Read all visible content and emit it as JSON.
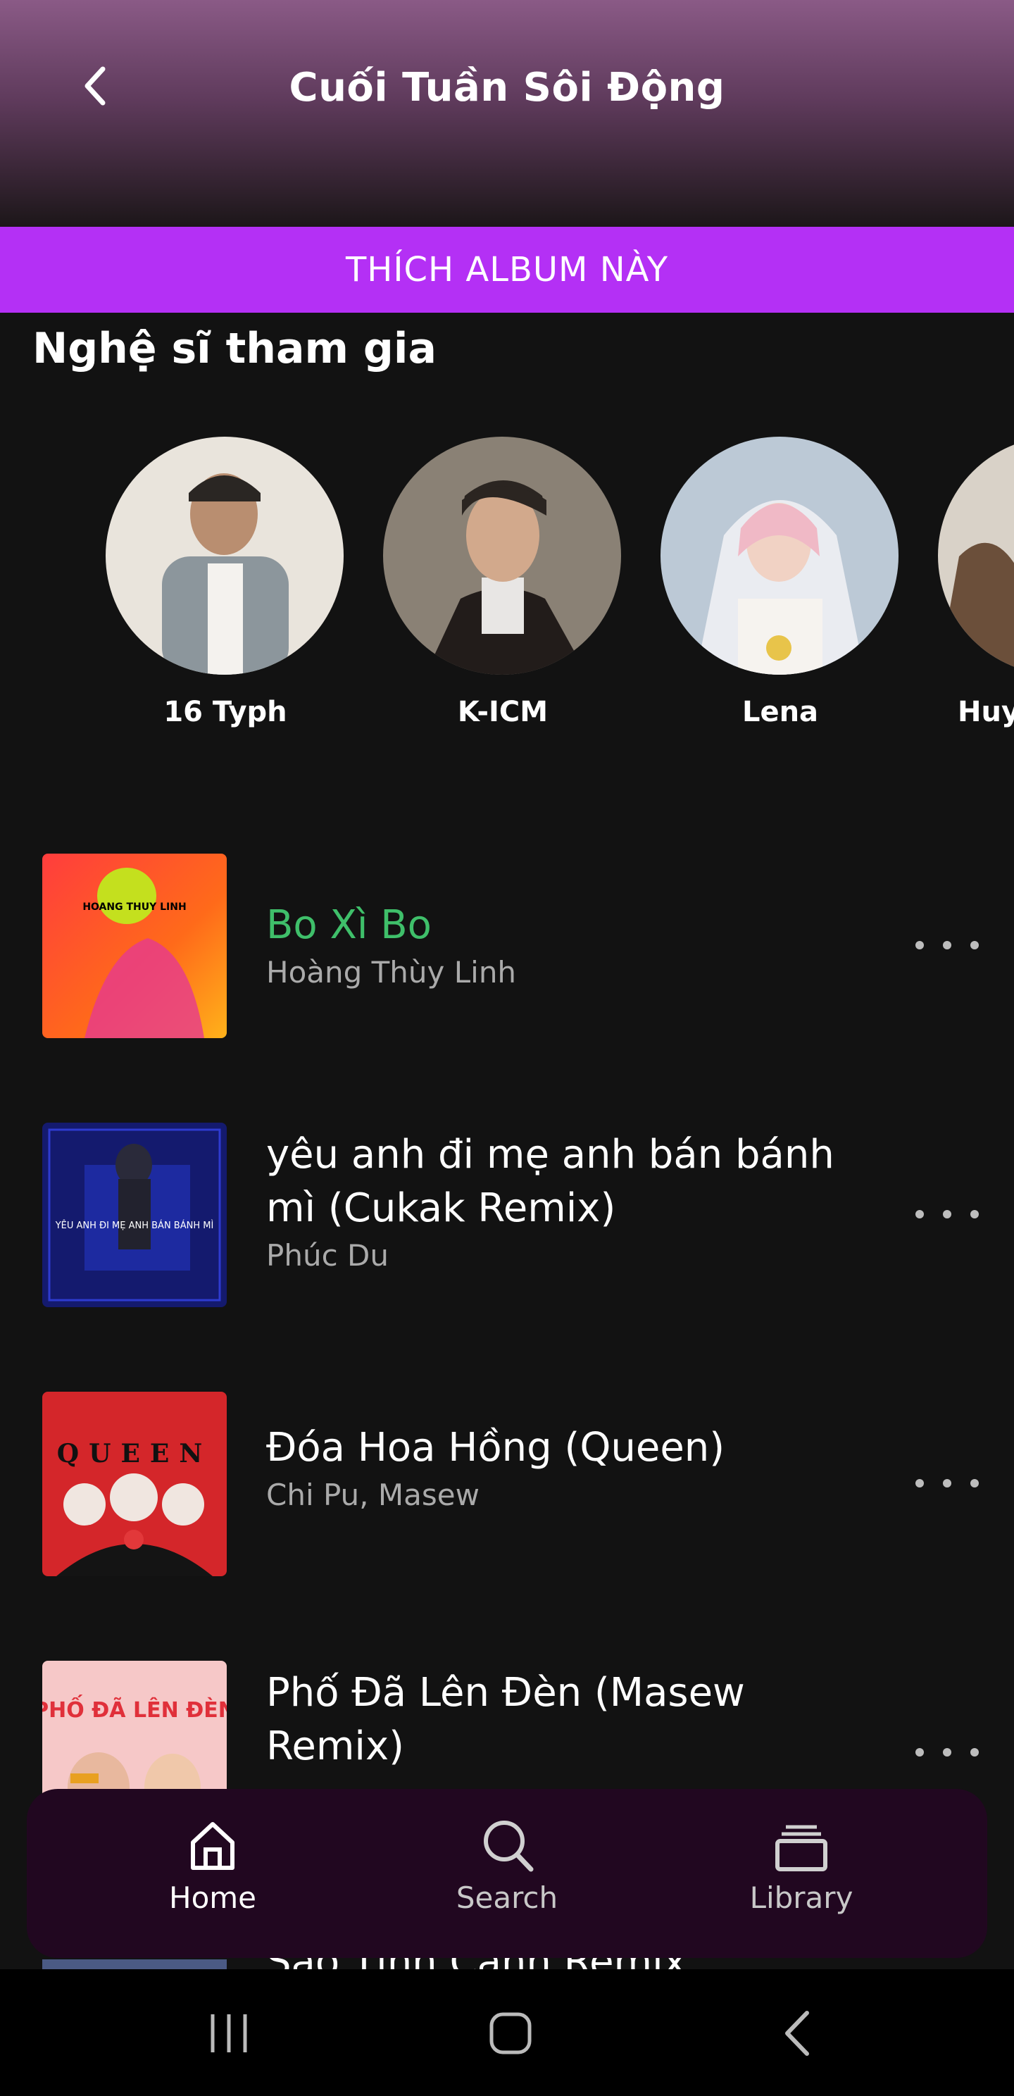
{
  "header": {
    "title": "Cuối Tuần Sôi Động",
    "back_icon": "chevron-left-icon"
  },
  "like_button": {
    "label": "THÍCH ALBUM NÀY",
    "color": "#b430f5"
  },
  "artists_section": {
    "title": "Nghệ sĩ tham gia",
    "artists": [
      {
        "name": "16 Typh"
      },
      {
        "name": "K-ICM"
      },
      {
        "name": "Lena"
      },
      {
        "name": "Huy"
      }
    ]
  },
  "tracks": [
    {
      "title": "Bo Xì Bo",
      "artist": "Hoàng Thùy Linh",
      "playing": true,
      "cover_text": "HOANG THUY LINH"
    },
    {
      "title": "yêu anh đi mẹ anh bán bánh mì (Cukak Remix)",
      "artist": "Phúc Du",
      "playing": false,
      "cover_text": "YÊU ANH ĐI MẸ ANH BÁN BÁNH MÌ"
    },
    {
      "title": "Đóa Hoa Hồng (Queen)",
      "artist": "Chi Pu, Masew",
      "playing": false,
      "cover_text": "QUEEN"
    },
    {
      "title": "Phố Đã Lên Đèn (Masew Remix)",
      "artist": "",
      "playing": false,
      "cover_text": "PHỐ ĐÃ LÊN ĐÈN"
    },
    {
      "title": "Sao Tình Cảnh Remix",
      "artist": "",
      "playing": false,
      "cover_text": ""
    }
  ],
  "bottom_nav": {
    "items": [
      {
        "label": "Home",
        "icon": "home-icon",
        "active": true
      },
      {
        "label": "Search",
        "icon": "search-icon",
        "active": false
      },
      {
        "label": "Library",
        "icon": "library-icon",
        "active": false
      }
    ]
  },
  "colors": {
    "accent_playing": "#3fbf6a",
    "background": "#121212",
    "nav_bg": "#210720"
  }
}
